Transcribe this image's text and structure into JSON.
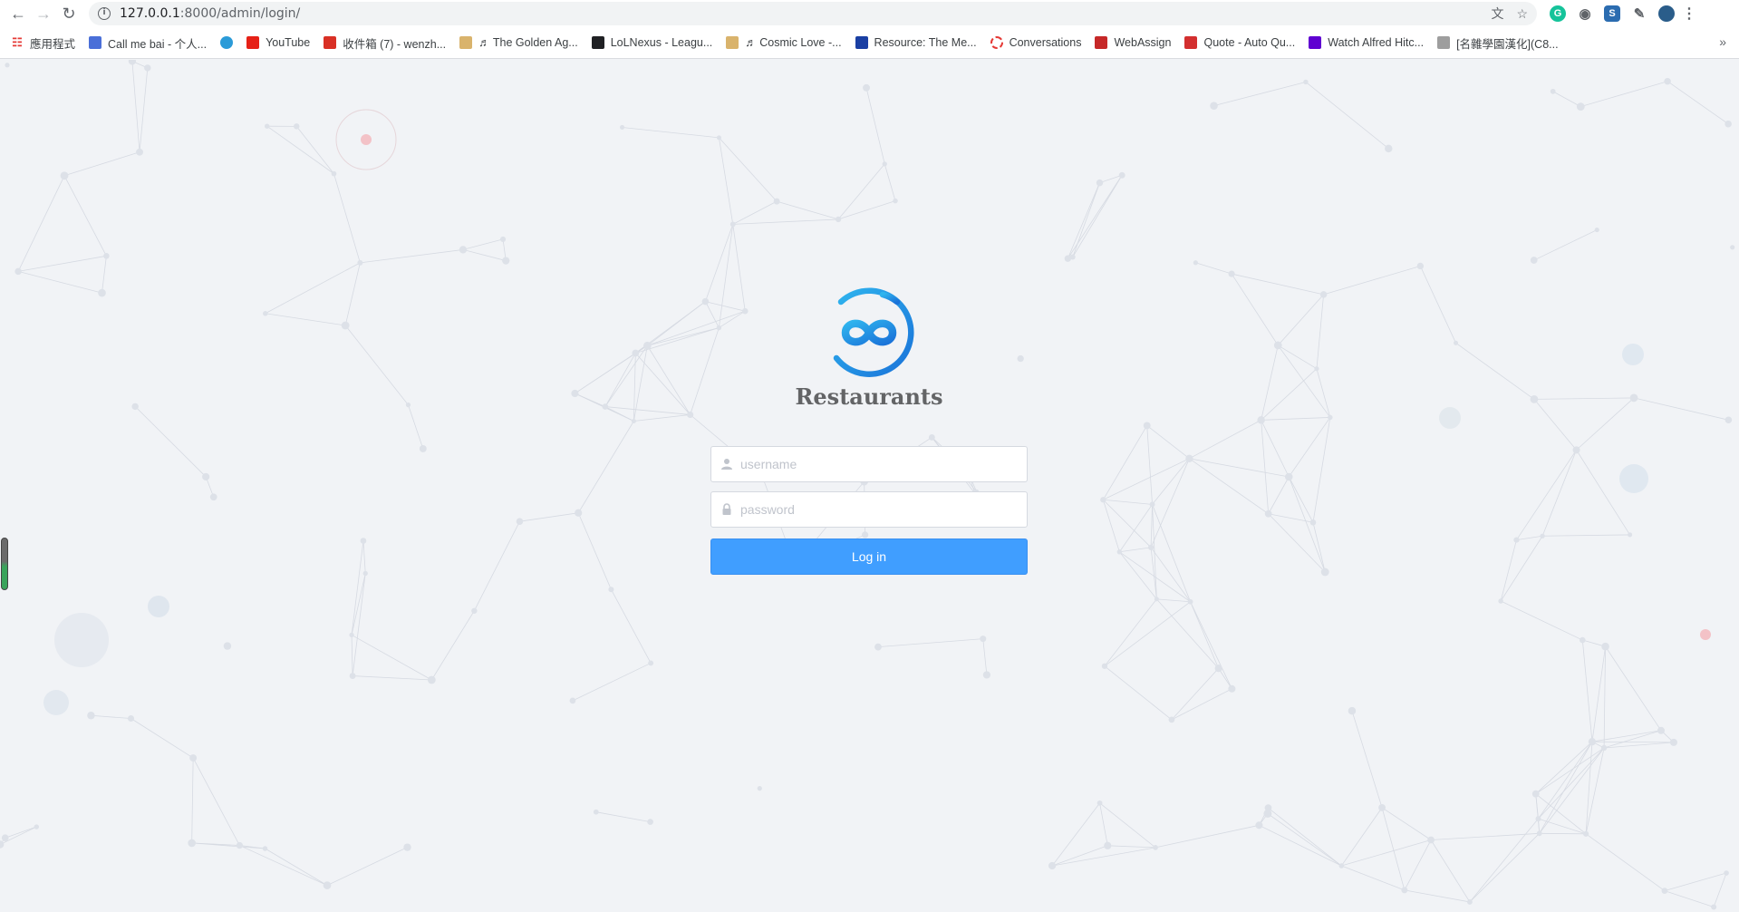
{
  "browser": {
    "url_host": "127.0.0.1",
    "url_rest": ":8000/admin/login/",
    "icons": [
      "back-arrow-icon",
      "forward-arrow-icon",
      "reload-icon",
      "site-info-icon",
      "translate-icon",
      "star-icon"
    ]
  },
  "bookmarks": [
    {
      "label": "應用程式",
      "icon": "apps-grid-icon",
      "color": "#e53935"
    },
    {
      "label": "Call me bai - 个人...",
      "icon": "bookmark-site-icon",
      "color": "#4a6fd8"
    },
    {
      "label": "",
      "icon": "chrome-ball-icon",
      "color": "#2b9bd8"
    },
    {
      "label": "YouTube",
      "icon": "youtube-icon",
      "color": "#e62117"
    },
    {
      "label": "收件箱 (7) - wenzh...",
      "icon": "gmail-icon",
      "color": "#d93025"
    },
    {
      "label": "♬ The Golden Ag...",
      "icon": "note-icon",
      "color": "#d9b36c"
    },
    {
      "label": "LoLNexus - Leagu...",
      "icon": "trophy-icon",
      "color": "#202124"
    },
    {
      "label": "♬ Cosmic Love -...",
      "icon": "note-icon",
      "color": "#d9b36c"
    },
    {
      "label": "Resource: The Me...",
      "icon": "resource-icon",
      "color": "#1a3fa3"
    },
    {
      "label": "Conversations",
      "icon": "conversations-icon",
      "color": "#e53935"
    },
    {
      "label": "WebAssign",
      "icon": "webassign-icon",
      "color": "#c62828"
    },
    {
      "label": "Quote - Auto Qu...",
      "icon": "quote-icon",
      "color": "#d32f2f"
    },
    {
      "label": "Watch Alfred Hitc...",
      "icon": "yahoo-icon",
      "color": "#5f01d1"
    },
    {
      "label": "[名雜學園漢化](C8...",
      "icon": "site-icon",
      "color": "#9e9e9e"
    }
  ],
  "login": {
    "brand": "Restaurants",
    "username_placeholder": "username",
    "password_placeholder": "password",
    "button_label": "Log in",
    "accent": "#409eff"
  }
}
